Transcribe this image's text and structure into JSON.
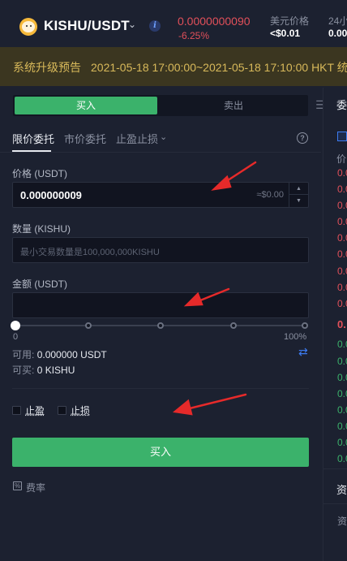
{
  "header": {
    "pair": "KISHU/USDT",
    "price": "0.0000000090",
    "change": "-6.25%",
    "usd_label": "美元价格",
    "usd_value": "<$0.01",
    "h24_label": "24小",
    "h24_value": "0.00"
  },
  "notice": {
    "title": "系统升级预告",
    "text": "2021-05-18 17:00:00~2021-05-18 17:10:00 HKT 统"
  },
  "side_toggle": {
    "buy": "买入",
    "sell": "卖出"
  },
  "order_tabs": {
    "limit": "限价委托",
    "market": "市价委托",
    "stop": "止盈止损"
  },
  "price_field": {
    "label": "价格 (USDT)",
    "value": "0.000000009",
    "approx": "≈$0.00"
  },
  "amount_field": {
    "label": "数量 (KISHU)",
    "placeholder": "最小交易数量是100,000,000KISHU"
  },
  "total_field": {
    "label": "金额 (USDT)",
    "value": ""
  },
  "slider": {
    "min_label": "0",
    "max_label": "100%",
    "value_percent": 0
  },
  "available": {
    "label": "可用:",
    "value": "0.000000 USDT",
    "buyable_label": "可买:",
    "buyable_value": "0 KISHU"
  },
  "options": {
    "take_profit": "止盈",
    "stop_loss": "止损"
  },
  "buy_button": "买入",
  "fee_label": "费率",
  "orderbook": {
    "title": "委",
    "column_head": "价",
    "sell_prices": [
      "0.0",
      "0.0",
      "0.0",
      "0.0",
      "0.0",
      "0.0",
      "0.0",
      "0.0",
      "0.0"
    ],
    "mid_price": "0.",
    "buy_prices": [
      "0.0",
      "0.0",
      "0.0",
      "0.0",
      "0.0",
      "0.0",
      "0.0",
      "0.0"
    ]
  },
  "bottom_panel": {
    "title": "资",
    "sub": "资"
  },
  "colors": {
    "buy_green": "#3bb26b",
    "sell_red": "#e2505a",
    "notice_bg": "#3b3620",
    "annotation_red": "#e62a2a"
  }
}
